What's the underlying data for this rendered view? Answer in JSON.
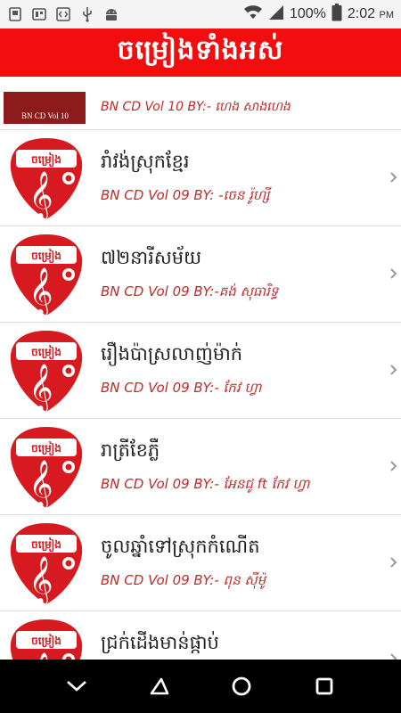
{
  "status_bar": {
    "battery_percent": "100%",
    "time": "2:02",
    "time_suffix": "PM"
  },
  "app_bar": {
    "title": "ចម្រៀងទាំងអស់"
  },
  "thumbnail_text": "ចម្រៀង",
  "partial_row": {
    "title": "BN CD Vol 10 BY:- ហេង សាងហេង",
    "cover_label": "BN CD Vol 10"
  },
  "songs": [
    {
      "title": "រាំវង់ស្រុកខ្មែរ",
      "subtitle": "BN CD Vol 09 BY: -ចេន រ៉ូហ្សី"
    },
    {
      "title": "៧២នារីសម័យ",
      "subtitle": "BN CD Vol 09 BY:-គង់ សុធារិទ្ធ"
    },
    {
      "title": "រឿងប៉ាស្រលាញ់ម៉ាក់",
      "subtitle": "BN CD Vol 09 BY:- កែវ ហ្វា"
    },
    {
      "title": "រាត្រីខែភ្លឺ",
      "subtitle": "BN CD Vol 09 BY:- អែនជូ ft កែវ ហ្វា"
    },
    {
      "title": "ចូលឆ្នាំទៅស្រុកកំណើត",
      "subtitle": "BN CD Vol 09 BY:- ពុន ស៊ីម៉ូ"
    },
    {
      "title": "ជ្រក់ដើងមាន់ផ្កាប់",
      "subtitle": ""
    }
  ]
}
